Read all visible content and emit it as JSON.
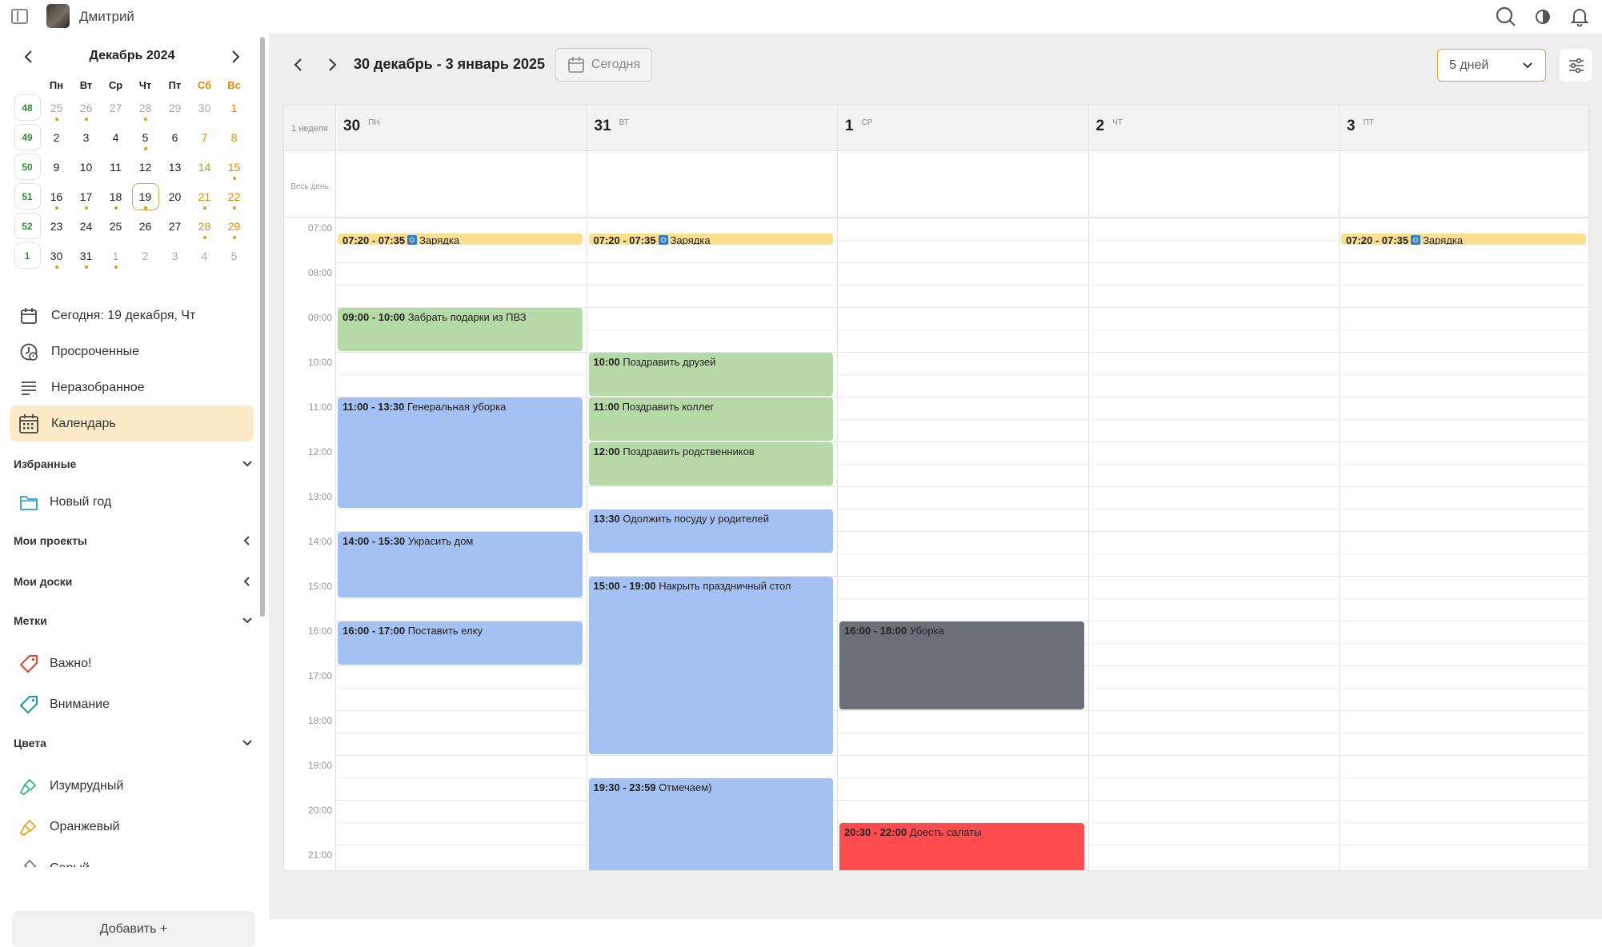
{
  "user": {
    "name": "Дмитрий"
  },
  "mini_calendar": {
    "title": "Декабрь 2024",
    "weekdays": [
      "Пн",
      "Вт",
      "Ср",
      "Чт",
      "Пт",
      "Сб",
      "Вс"
    ],
    "weeks": [
      {
        "num": "48",
        "days": [
          {
            "d": "25",
            "m": true,
            "dot": true
          },
          {
            "d": "26",
            "m": true,
            "dot": true
          },
          {
            "d": "27",
            "m": true
          },
          {
            "d": "28",
            "m": true,
            "dot": true
          },
          {
            "d": "29",
            "m": true
          },
          {
            "d": "30",
            "m": true
          },
          {
            "d": "1",
            "w": true
          }
        ]
      },
      {
        "num": "49",
        "days": [
          {
            "d": "2"
          },
          {
            "d": "3"
          },
          {
            "d": "4"
          },
          {
            "d": "5",
            "dot": true
          },
          {
            "d": "6"
          },
          {
            "d": "7",
            "w": true
          },
          {
            "d": "8",
            "w": true
          }
        ]
      },
      {
        "num": "50",
        "days": [
          {
            "d": "9"
          },
          {
            "d": "10"
          },
          {
            "d": "11"
          },
          {
            "d": "12"
          },
          {
            "d": "13"
          },
          {
            "d": "14",
            "w": true
          },
          {
            "d": "15",
            "w": true,
            "dot": true
          }
        ]
      },
      {
        "num": "51",
        "days": [
          {
            "d": "16",
            "dot": true
          },
          {
            "d": "17",
            "dot": true
          },
          {
            "d": "18",
            "dot": true
          },
          {
            "d": "19",
            "today": true,
            "dot": true
          },
          {
            "d": "20"
          },
          {
            "d": "21",
            "w": true,
            "dot": true
          },
          {
            "d": "22",
            "w": true,
            "dot": true
          }
        ]
      },
      {
        "num": "52",
        "days": [
          {
            "d": "23"
          },
          {
            "d": "24"
          },
          {
            "d": "25"
          },
          {
            "d": "26"
          },
          {
            "d": "27"
          },
          {
            "d": "28",
            "w": true,
            "dot": true
          },
          {
            "d": "29",
            "w": true,
            "dot": true
          }
        ]
      },
      {
        "num": "1",
        "days": [
          {
            "d": "30",
            "dot": true
          },
          {
            "d": "31",
            "dot": true
          },
          {
            "d": "1",
            "m": true,
            "dot": true
          },
          {
            "d": "2",
            "m": true
          },
          {
            "d": "3",
            "m": true
          },
          {
            "d": "4",
            "m": true
          },
          {
            "d": "5",
            "m": true
          }
        ]
      }
    ]
  },
  "nav": {
    "today": "Сегодня: 19 декабря, Чт",
    "overdue": "Просроченные",
    "unsorted": "Неразобранное",
    "calendar": "Календарь"
  },
  "sections": {
    "favorites": "Избранные",
    "favorite_item": "Новый год",
    "projects": "Мои проекты",
    "boards": "Мои доски",
    "tags": "Метки",
    "tag_important": "Важно!",
    "tag_attention": "Внимание",
    "colors": "Цвета",
    "color_emerald": "Изумрудный",
    "color_orange": "Оранжевый",
    "color_gray": "Серый"
  },
  "add_button": "Добавить +",
  "main": {
    "range_title": "30 декабрь - 3 январь 2025",
    "today_button": "Сегодня",
    "view_select": "5 дней",
    "week_label": "1 неделя",
    "allday_label": "Весь день"
  },
  "days": [
    {
      "num": "30",
      "wd": "ПН"
    },
    {
      "num": "31",
      "wd": "ВТ"
    },
    {
      "num": "1",
      "wd": "СР"
    },
    {
      "num": "2",
      "wd": "ЧТ"
    },
    {
      "num": "3",
      "wd": "ПТ"
    }
  ],
  "hours": [
    "07:00",
    "08:00",
    "09:00",
    "10:00",
    "11:00",
    "12:00",
    "13:00",
    "14:00",
    "15:00",
    "16:00",
    "17:00",
    "18:00",
    "19:00",
    "20:00",
    "21:00"
  ],
  "events": [
    {
      "day": 0,
      "start": "07:20",
      "end": "07:35",
      "time": "07:20 - 07:35",
      "title": "Зарядка",
      "color": "yellow",
      "sync": true
    },
    {
      "day": 1,
      "start": "07:20",
      "end": "07:35",
      "time": "07:20 - 07:35",
      "title": "Зарядка",
      "color": "yellow",
      "sync": true
    },
    {
      "day": 4,
      "start": "07:20",
      "end": "07:35",
      "time": "07:20 - 07:35",
      "title": "Зарядка",
      "color": "yellow",
      "sync": true
    },
    {
      "day": 0,
      "start": "09:00",
      "end": "10:00",
      "time": "09:00 - 10:00",
      "title": "Забрать подарки из ПВЗ",
      "color": "green"
    },
    {
      "day": 0,
      "start": "11:00",
      "end": "13:30",
      "time": "11:00 - 13:30",
      "title": "Генеральная уборка",
      "color": "blue"
    },
    {
      "day": 0,
      "start": "14:00",
      "end": "15:30",
      "time": "14:00 - 15:30",
      "title": "Украсить дом",
      "color": "blue"
    },
    {
      "day": 0,
      "start": "16:00",
      "end": "17:00",
      "time": "16:00 - 17:00",
      "title": "Поставить елку",
      "color": "blue"
    },
    {
      "day": 1,
      "start": "10:00",
      "end": "11:00",
      "time": "10:00",
      "title": "Поздравить друзей",
      "color": "green"
    },
    {
      "day": 1,
      "start": "11:00",
      "end": "12:00",
      "time": "11:00",
      "title": "Поздравить коллег",
      "color": "green"
    },
    {
      "day": 1,
      "start": "12:00",
      "end": "13:00",
      "time": "12:00",
      "title": "Поздравить родственников",
      "color": "green"
    },
    {
      "day": 1,
      "start": "13:30",
      "end": "14:30",
      "time": "13:30",
      "title": "Одолжить посуду у родителей",
      "color": "blue"
    },
    {
      "day": 1,
      "start": "15:00",
      "end": "19:00",
      "time": "15:00 - 19:00",
      "title": "Накрыть праздничный стол",
      "color": "blue"
    },
    {
      "day": 1,
      "start": "19:30",
      "end": "23:59",
      "time": "19:30 - 23:59",
      "title": "Отмечаем)",
      "color": "blue"
    },
    {
      "day": 2,
      "start": "16:00",
      "end": "18:00",
      "time": "16:00 - 18:00",
      "title": "Уборка",
      "color": "gray"
    },
    {
      "day": 2,
      "start": "20:30",
      "end": "22:00",
      "time": "20:30 - 22:00",
      "title": "Доесть салаты",
      "color": "red"
    }
  ]
}
